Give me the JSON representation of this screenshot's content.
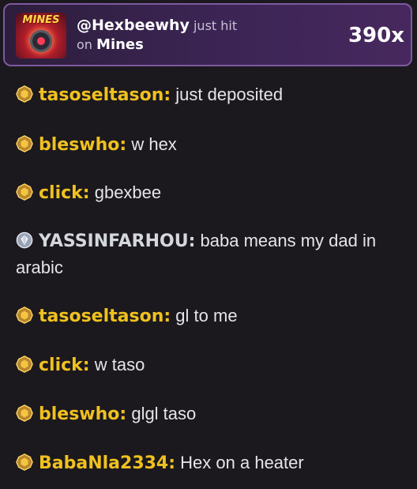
{
  "banner": {
    "game_logo_text": "MINES",
    "user": "@Hexbeewhy",
    "action": "just hit",
    "on_word": "on",
    "game": "Mines",
    "multiplier": "390x"
  },
  "messages": [
    {
      "rank": "gold",
      "rank_icon": "gold-rank-icon",
      "username": "tasoseltason:",
      "text": "just deposited"
    },
    {
      "rank": "gold",
      "rank_icon": "gold-rank-icon",
      "username": "bleswho:",
      "text": "w hex"
    },
    {
      "rank": "gold",
      "rank_icon": "gold-rank-icon",
      "username": "click:",
      "text": "gbexbee"
    },
    {
      "rank": "diamond",
      "rank_icon": "diamond-rank-icon",
      "username": "YASSINFARHOU:",
      "text": "baba means my dad in arabic"
    },
    {
      "rank": "gold",
      "rank_icon": "gold-rank-icon",
      "username": "tasoseltason:",
      "text": "gl to me"
    },
    {
      "rank": "gold",
      "rank_icon": "gold-rank-icon",
      "username": "click:",
      "text": "w taso"
    },
    {
      "rank": "gold",
      "rank_icon": "gold-rank-icon",
      "username": "bleswho:",
      "text": "glgl taso"
    },
    {
      "rank": "gold",
      "rank_icon": "gold-rank-icon",
      "username": "BabaNla2334:",
      "text": "Hex on a heater"
    }
  ],
  "colors": {
    "background": "#1b191e",
    "username_gold": "#f0c11f",
    "username_diamond": "#d4d7de",
    "banner_border": "#7d5a9f"
  }
}
